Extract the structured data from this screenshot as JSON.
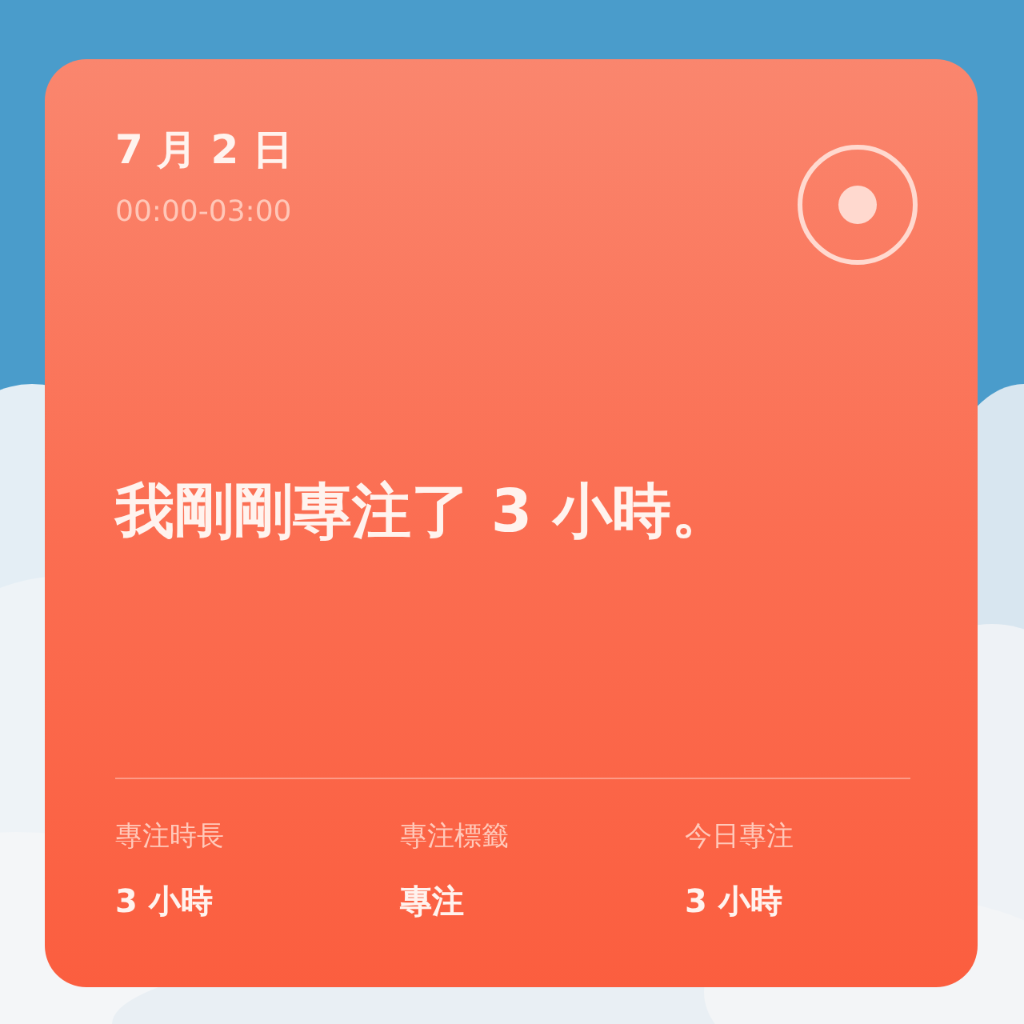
{
  "card": {
    "date": "7 月 2 日",
    "time_range": "00:00-03:00",
    "headline": "我剛剛專注了 3 小時。",
    "stats": [
      {
        "label": "專注時長",
        "value": "3 小時"
      },
      {
        "label": "專注標籤",
        "value": "專注"
      },
      {
        "label": "今日專注",
        "value": "3 小時"
      }
    ]
  }
}
